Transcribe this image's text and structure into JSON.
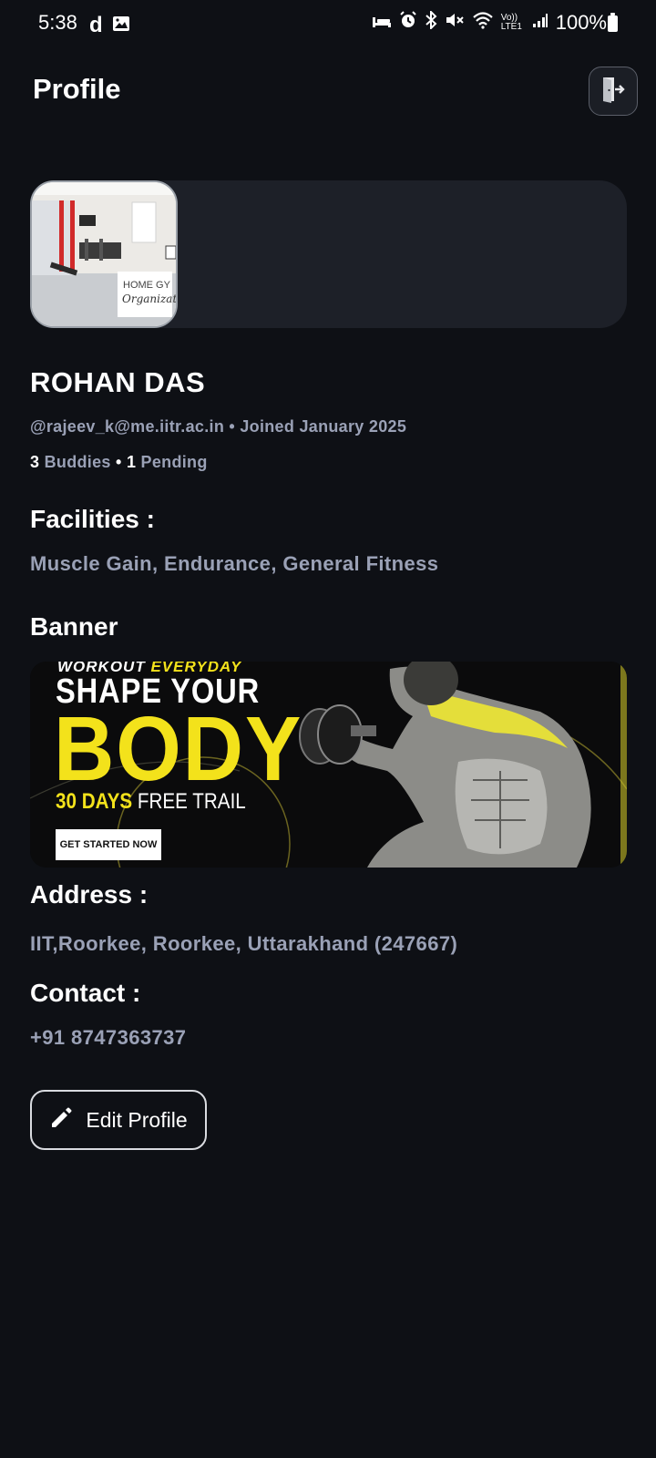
{
  "status_bar": {
    "time": "5:38",
    "battery_text": "100%",
    "icons": [
      "d-app-icon",
      "image-icon",
      "sleep-icon",
      "alarm-icon",
      "bluetooth-icon",
      "mute-icon",
      "wifi-icon",
      "volte-icon",
      "signal-icon",
      "battery-icon"
    ],
    "volte_label": "Vo)) LTE1"
  },
  "header": {
    "title": "Profile",
    "logout_icon": "logout-icon"
  },
  "gym_thumbnail": {
    "caption_line1": "HOME GY",
    "caption_line2": "Organizat"
  },
  "profile": {
    "name": "ROHAN DAS",
    "email": "@rajeev_k@me.iitr.ac.in",
    "separator": " • ",
    "joined": "Joined January 2025",
    "buddies_count": "3",
    "buddies_label": " Buddies ",
    "pending_count": "1",
    "pending_label": " Pending"
  },
  "facilities": {
    "label": "Facilities :",
    "value": "Muscle Gain, Endurance, General Fitness"
  },
  "banner": {
    "label": "Banner",
    "kicker_white": "WORKOUT ",
    "kicker_yellow": "EVERYDAY",
    "line1": "SHAPE YOUR",
    "line2": "BODY",
    "line3_yellow": "30 DAYS",
    "line3_white": " FREE TRAIL",
    "cta": "GET STARTED NOW"
  },
  "address": {
    "label": "Address :",
    "value": "IIT,Roorkee, Roorkee, Uttarakhand (247667)"
  },
  "contact": {
    "label": "Contact :",
    "value": "+91 8747363737"
  },
  "actions": {
    "edit_label": "Edit Profile",
    "edit_icon": "pencil-icon"
  },
  "colors": {
    "background": "#0e1015",
    "card": "#1d2028",
    "muted_text": "#9aa1b6",
    "banner_yellow": "#f3e21b"
  }
}
